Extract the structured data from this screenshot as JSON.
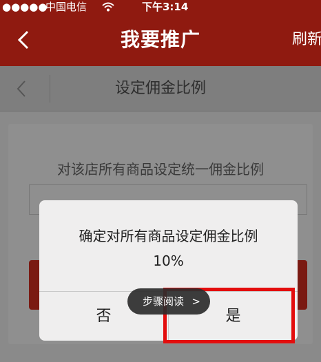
{
  "status_bar": {
    "signal": "●●●●●",
    "carrier": "中国电信",
    "wifi_icon": "wifi-icon",
    "time": "下午3:14"
  },
  "nav": {
    "title": "我要推广",
    "refresh_label": "刷新"
  },
  "sub_header": {
    "title": "设定佣金比例"
  },
  "content": {
    "prompt": "对该店所有商品设定统一佣金比例"
  },
  "dialog": {
    "message_line1": "确定对所有商品设定佣金比例",
    "message_line2": "10%",
    "no_label": "否",
    "yes_label": "是"
  },
  "overlay": {
    "reading_label": "步骤阅读",
    "reading_chevron": ">"
  },
  "colors": {
    "brand_red": "#8f1a10",
    "highlight": "#e30d0d"
  }
}
